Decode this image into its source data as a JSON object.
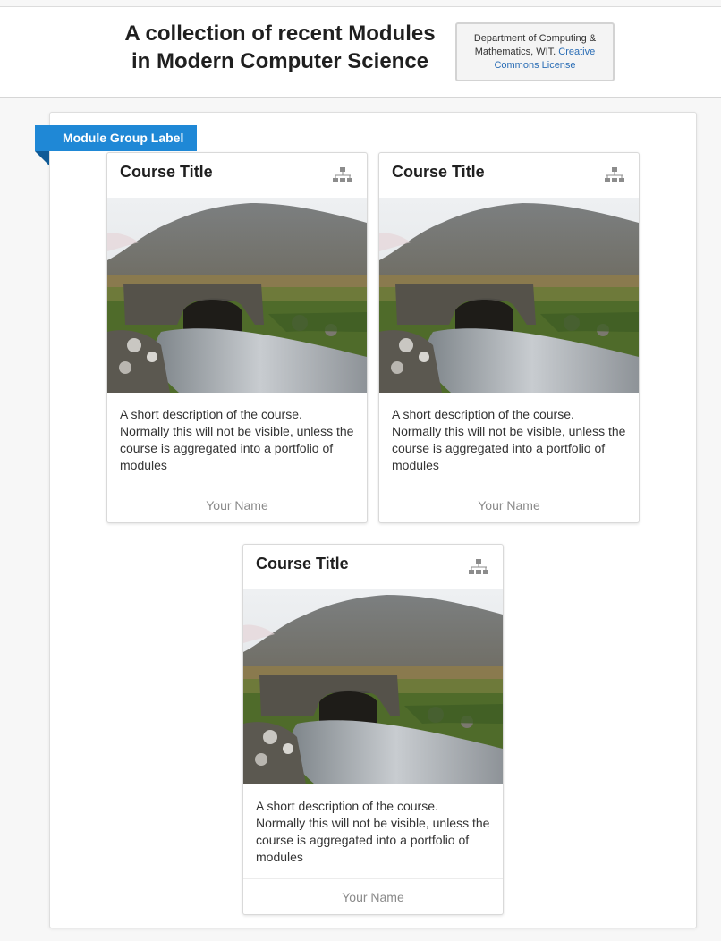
{
  "header": {
    "title_line1": "A collection of recent Modules",
    "title_line2": "in Modern Computer Science",
    "license_text": "Department of Computing & Mathematics, WIT.",
    "license_link": "Creative Commons License"
  },
  "group": {
    "label": "Module Group Label"
  },
  "cards": [
    {
      "title": "Course Title",
      "icon": "hierarchy-icon",
      "description": "A short description of the course. Normally this will not be visible, unless the course is aggregated into a portfolio of modules",
      "author": "Your Name"
    },
    {
      "title": "Course Title",
      "icon": "hierarchy-icon",
      "description": "A short description of the course. Normally this will not be visible, unless the course is aggregated into a portfolio of modules",
      "author": "Your Name"
    },
    {
      "title": "Course Title",
      "icon": "hierarchy-icon",
      "description": "A short description of the course. Normally this will not be visible, unless the course is aggregated into a portfolio of modules",
      "author": "Your Name"
    }
  ],
  "colors": {
    "ribbon": "#1f88d6",
    "link": "#2a6db5"
  }
}
